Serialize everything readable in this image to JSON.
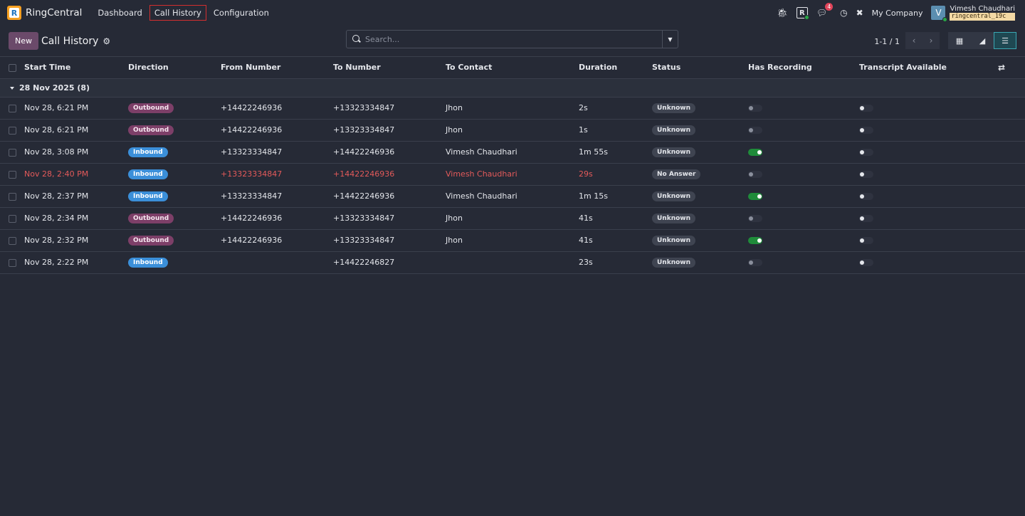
{
  "nav": {
    "brand": "RingCentral",
    "items": [
      "Dashboard",
      "Call History",
      "Configuration"
    ],
    "logo_letter": "R",
    "rc_letter": "R",
    "badge_count": "4",
    "company": "My Company",
    "avatar_letter": "V",
    "user_name": "Vimesh Chaudhari",
    "db_name": "ringcentral_19c"
  },
  "control": {
    "new_label": "New",
    "title": "Call History",
    "search_placeholder": "Search...",
    "pager": "1-1 / 1"
  },
  "table": {
    "headers": [
      "Start Time",
      "Direction",
      "From Number",
      "To Number",
      "To Contact",
      "Duration",
      "Status",
      "Has Recording",
      "Transcript Available"
    ],
    "group_label": "28 Nov 2025 (8)",
    "rows": [
      {
        "start": "Nov 28, 6:21 PM",
        "direction": "Outbound",
        "from": "+14422246936",
        "to": "+13323334847",
        "contact": "Jhon",
        "duration": "2s",
        "status": "Unknown",
        "recording": false,
        "transcript": false
      },
      {
        "start": "Nov 28, 6:21 PM",
        "direction": "Outbound",
        "from": "+14422246936",
        "to": "+13323334847",
        "contact": "Jhon",
        "duration": "1s",
        "status": "Unknown",
        "recording": false,
        "transcript": false
      },
      {
        "start": "Nov 28, 3:08 PM",
        "direction": "Inbound",
        "from": "+13323334847",
        "to": "+14422246936",
        "contact": "Vimesh Chaudhari",
        "duration": "1m 55s",
        "status": "Unknown",
        "recording": true,
        "transcript": false
      },
      {
        "start": "Nov 28, 2:40 PM",
        "direction": "Inbound",
        "from": "+13323334847",
        "to": "+14422246936",
        "contact": "Vimesh Chaudhari",
        "duration": "29s",
        "status": "No Answer",
        "recording": false,
        "transcript": false
      },
      {
        "start": "Nov 28, 2:37 PM",
        "direction": "Inbound",
        "from": "+13323334847",
        "to": "+14422246936",
        "contact": "Vimesh Chaudhari",
        "duration": "1m 15s",
        "status": "Unknown",
        "recording": true,
        "transcript": false
      },
      {
        "start": "Nov 28, 2:34 PM",
        "direction": "Outbound",
        "from": "+14422246936",
        "to": "+13323334847",
        "contact": "Jhon",
        "duration": "41s",
        "status": "Unknown",
        "recording": false,
        "transcript": false
      },
      {
        "start": "Nov 28, 2:32 PM",
        "direction": "Outbound",
        "from": "+14422246936",
        "to": "+13323334847",
        "contact": "Jhon",
        "duration": "41s",
        "status": "Unknown",
        "recording": true,
        "transcript": false
      },
      {
        "start": "Nov 28, 2:22 PM",
        "direction": "Inbound",
        "from": "",
        "to": "+14422246827",
        "contact": "",
        "duration": "23s",
        "status": "Unknown",
        "recording": false,
        "transcript": false
      }
    ]
  },
  "colors": {
    "background": "#262a36",
    "outbound": "#7d3f68",
    "inbound": "#3b8fd9",
    "alert_text": "#e35a5a",
    "toggle_on": "#1f8b3a",
    "active_nav_border": "#d32f2f"
  },
  "icons": [
    "bug-icon",
    "chat-icon",
    "clock-icon",
    "tools-icon",
    "gear-icon",
    "search-icon",
    "list-view-icon",
    "graph-view-icon",
    "pivot-view-icon",
    "column-adjust-icon"
  ]
}
